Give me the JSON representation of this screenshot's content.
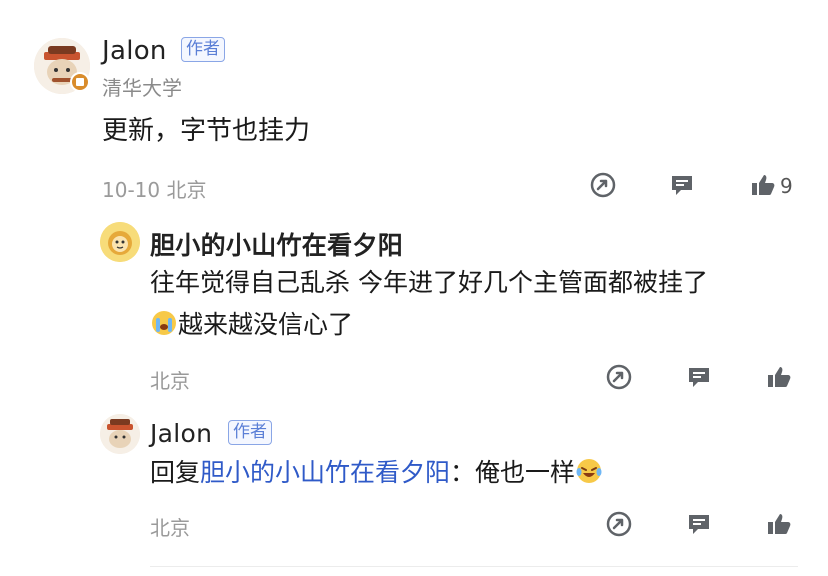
{
  "main_comment": {
    "author": "Jalon",
    "author_badge": "作者",
    "school": "清华大学",
    "text": "更新，字节也挂力",
    "meta": "10-10 北京",
    "like_count": "9"
  },
  "reply1": {
    "author": "胆小的小山竹在看夕阳",
    "text_line1": "往年觉得自己乱杀 今年进了好几个主管面都被挂了",
    "text_line2": "越来越没信心了",
    "meta": "北京"
  },
  "reply2": {
    "author": "Jalon",
    "author_badge": "作者",
    "reply_prefix": "回复",
    "reply_target": "胆小的小山竹在看夕阳",
    "reply_colon": "：",
    "text": "俺也一样",
    "meta": "北京"
  },
  "colors": {
    "link": "#2f5ac8",
    "icon": "#5f6368",
    "meta": "#9a9a9a"
  },
  "icons": {
    "share": "share-icon",
    "comment": "comment-icon",
    "like": "thumbs-up-icon"
  }
}
